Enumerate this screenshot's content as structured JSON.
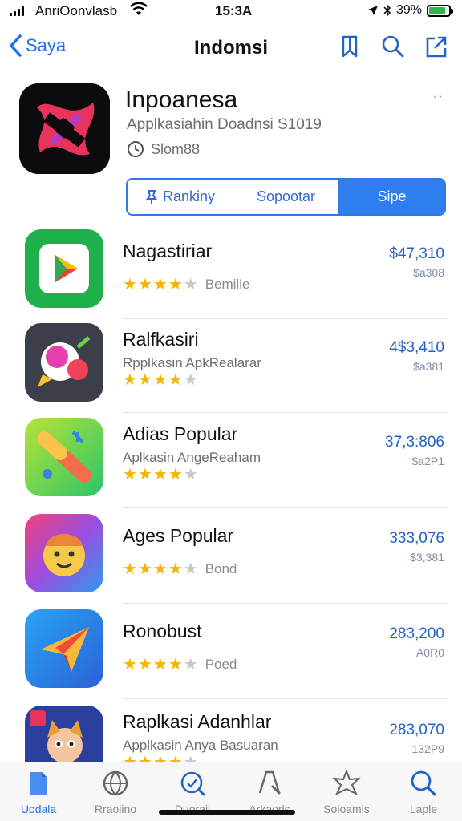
{
  "status_bar": {
    "carrier": "AnriOonvlasb",
    "time": "15:3A",
    "battery": "39%",
    "battery_level": 0.85
  },
  "nav": {
    "back_label": "Saya",
    "title": "Indomsi",
    "icons": [
      "bookmark-icon",
      "search-icon",
      "share-icon"
    ]
  },
  "app": {
    "name": "Inpoanesa",
    "subtitle": "Applkasiahin Doadnsi S1019",
    "meta": "Slom88",
    "dots": "··"
  },
  "segments": [
    {
      "label": "Rankiny",
      "active": false
    },
    {
      "label": "Sopootar",
      "active": false
    },
    {
      "label": "Sipe",
      "active": true
    }
  ],
  "apps": [
    {
      "name": "Nagastiriar",
      "subtitle": "",
      "rating": 4,
      "rating_label": "Bemille",
      "price": "$47,310",
      "price_sub": "$a308",
      "icon": "play-store-icon"
    },
    {
      "name": "Ralfkasiri",
      "subtitle": "Rpplkasin ApkRealarar",
      "rating": 4,
      "rating_label": "",
      "price": "4$3,410",
      "price_sub": "$a381",
      "icon": "chat-bubble-icon"
    },
    {
      "name": "Adias Popular",
      "subtitle": "Aplkasin AngeReaham",
      "rating": 4,
      "rating_label": "",
      "price": "37,3:806",
      "price_sub": "$a2P1",
      "icon": "paint-tool-icon"
    },
    {
      "name": "Ages Popular",
      "subtitle": "",
      "rating": 4,
      "rating_label": "Bond",
      "price": "333,076",
      "price_sub": "$3,381",
      "icon": "smiley-face-icon"
    },
    {
      "name": "Ronobust",
      "subtitle": "",
      "rating": 4,
      "rating_label": "Poed",
      "price": "283,200",
      "price_sub": "A0R0",
      "icon": "paper-plane-icon"
    },
    {
      "name": "Raplkasi Adanhlar",
      "subtitle": "Applkasin Anya Basuaran",
      "rating": 4,
      "rating_label": "",
      "price": "283,070",
      "price_sub": "132P9",
      "icon": "cartoon-character-icon"
    }
  ],
  "tabs": [
    {
      "label": "Uodala",
      "icon": "document-icon",
      "selected": true
    },
    {
      "label": "Rraoiino",
      "icon": "globe-icon",
      "selected": false
    },
    {
      "label": "Duoraii",
      "icon": "refresh-search-icon",
      "selected": false
    },
    {
      "label": "Arkaorls",
      "icon": "search-icon",
      "selected": false
    },
    {
      "label": "Soioamis",
      "icon": "star-burst-icon",
      "selected": false
    },
    {
      "label": "Laple",
      "icon": "magnifier-icon",
      "selected": false
    }
  ],
  "colors": {
    "accent": "#1a73e8",
    "star": "#f6b400",
    "price": "#2462c4"
  }
}
